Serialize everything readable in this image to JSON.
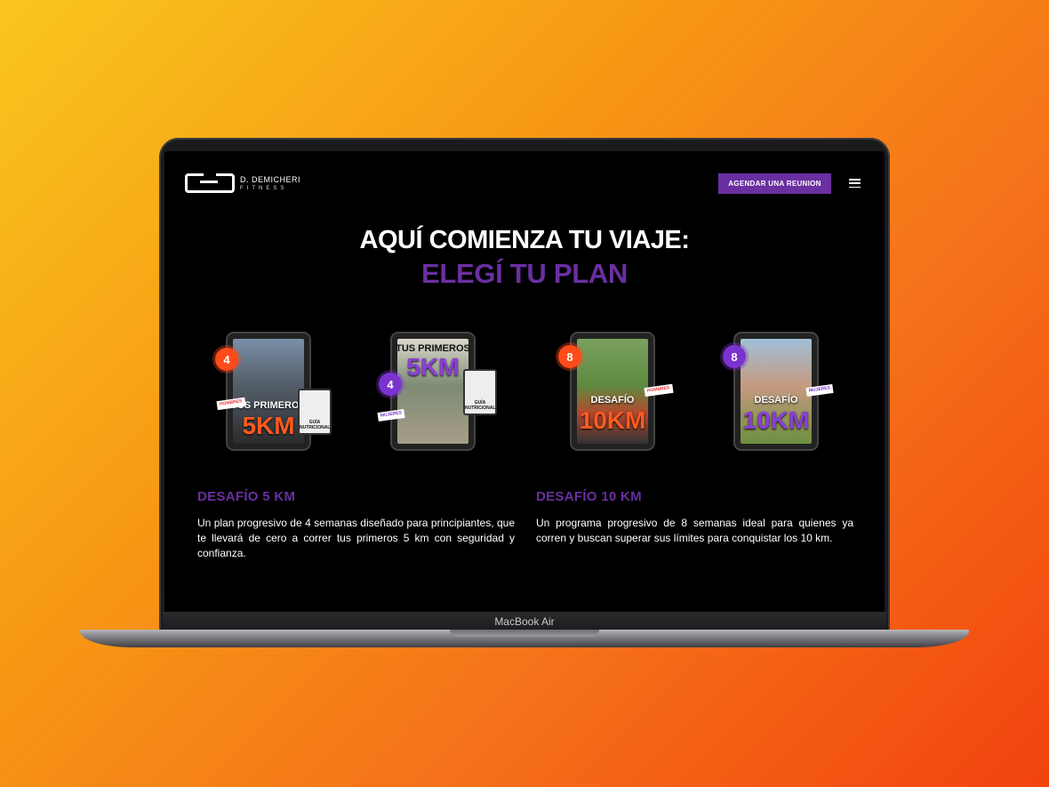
{
  "device": {
    "label": "MacBook Air"
  },
  "header": {
    "logo_name": "D. DEMICHERI",
    "logo_sub": "FITNESS",
    "cta_label": "AGENDAR UNA REUNION"
  },
  "hero": {
    "title": "AQUÍ COMIENZA TU VIAJE:",
    "subtitle": "ELEGÍ TU PLAN"
  },
  "products": [
    {
      "badge": "4",
      "line1": "TUS PRIMEROS",
      "big": "5KM",
      "sticker": "HOMBRES",
      "mini": "GUÍA NUTRICIONAL"
    },
    {
      "badge": "4",
      "line1": "TUS PRIMEROS",
      "big": "5KM",
      "sticker": "MUJERES",
      "mini": "GUÍA NUTRICIONAL"
    },
    {
      "badge": "8",
      "line1": "DESAFÍO",
      "big": "10KM",
      "sticker": "HOMBRES"
    },
    {
      "badge": "8",
      "line1": "DESAFÍO",
      "big": "10KM",
      "sticker": "MUJERES"
    }
  ],
  "plans": [
    {
      "title": "DESAFÍO 5 KM",
      "description": "Un plan progresivo de 4 semanas diseñado para principiantes, que te llevará de cero a correr tus primeros 5 km con seguridad y confianza."
    },
    {
      "title": "DESAFÍO 10 KM",
      "description": "Un programa progresivo de 8 semanas ideal para quienes ya corren y buscan superar sus límites para conquistar los 10 km."
    }
  ],
  "colors": {
    "accent": "#6a2fa0",
    "orange": "#ff4a1a",
    "background": "#000000"
  }
}
